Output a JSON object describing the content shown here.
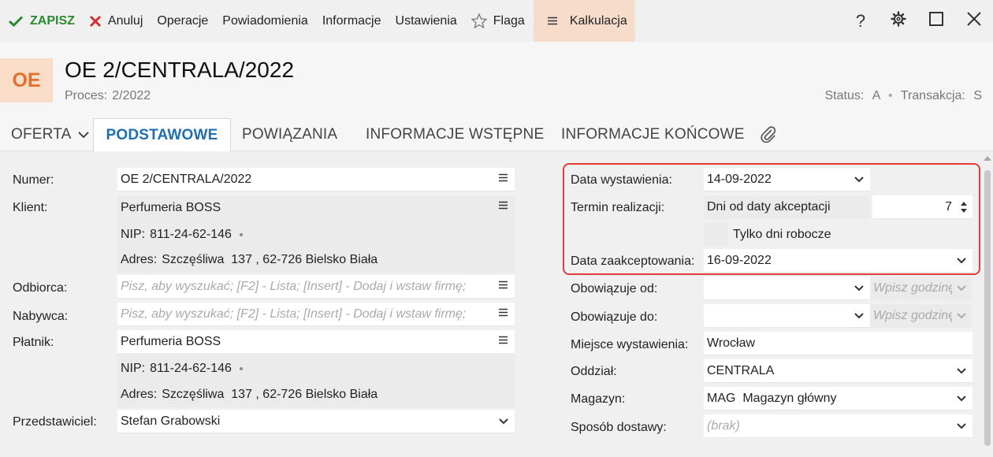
{
  "toolbar": {
    "save_label": "ZAPISZ",
    "cancel_label": "Anuluj",
    "operations_label": "Operacje",
    "notifications_label": "Powiadomienia",
    "information_label": "Informacje",
    "settings_label": "Ustawienia",
    "flag_label": "Flaga",
    "calculation_label": "Kalkulacja"
  },
  "header": {
    "badge": "OE",
    "title": "OE 2/CENTRALA/2022",
    "proces_label": "Proces:",
    "proces_value": "2/2022",
    "status_label": "Status:",
    "status_value": "A",
    "transaction_label": "Transakcja:",
    "transaction_value": "S"
  },
  "tabs": {
    "offer": "OFERTA",
    "basic": "PODSTAWOWE",
    "links": "POWIĄZANIA",
    "initial_info": "INFORMACJE WSTĘPNE",
    "final_info": "INFORMACJE KOŃCOWE"
  },
  "left": {
    "number_label": "Numer:",
    "number_value": "OE 2/CENTRALA/2022",
    "client_label": "Klient:",
    "client_value": "Perfumeria BOSS",
    "client_nip_label": "NIP:",
    "client_nip_value": "811-24-62-146",
    "client_address_label": "Adres:",
    "client_address_value": "Szczęśliwa  137 , 62-726 Bielsko Biała",
    "recipient_label": "Odbiorca:",
    "recipient_placeholder": "Pisz, aby wyszukać; [F2] - Lista; [Insert] - Dodaj i wstaw firmę;",
    "buyer_label": "Nabywca:",
    "buyer_placeholder": "Pisz, aby wyszukać; [F2] - Lista; [Insert] - Dodaj i wstaw firmę;",
    "payer_label": "Płatnik:",
    "payer_value": "Perfumeria BOSS",
    "payer_nip_label": "NIP:",
    "payer_nip_value": "811-24-62-146",
    "payer_address_label": "Adres:",
    "payer_address_value": "Szczęśliwa  137 , 62-726 Bielsko Biała",
    "representative_label": "Przedstawiciel:",
    "representative_value": "Stefan Grabowski"
  },
  "right": {
    "issue_date_label": "Data wystawienia:",
    "issue_date_value": "14-09-2022",
    "term_label": "Termin realizacji:",
    "term_mode": "Dni od daty akceptacji",
    "term_days": "7",
    "workdays_label": "Tylko dni robocze",
    "accept_date_label": "Data zaakceptowania:",
    "accept_date_value": "16-09-2022",
    "valid_from_label": "Obowiązuje od:",
    "valid_from_time_placeholder": "Wpisz godzinę",
    "valid_to_label": "Obowiązuje do:",
    "valid_to_time_placeholder": "Wpisz godzinę",
    "place_label": "Miejsce wystawienia:",
    "place_value": "Wrocław",
    "branch_label": "Oddział:",
    "branch_value": "CENTRALA",
    "warehouse_label": "Magazyn:",
    "warehouse_value": "MAG  Magazyn główny",
    "delivery_label": "Sposób dostawy:",
    "delivery_placeholder": "(brak)"
  },
  "colors": {
    "save_green": "#2b8a2b",
    "cancel_red": "#d32f2f",
    "badge_bg": "#f9ddc9",
    "badge_text": "#e0702b",
    "tab_active": "#1f6fb2",
    "highlight_red": "#e53b3b"
  }
}
